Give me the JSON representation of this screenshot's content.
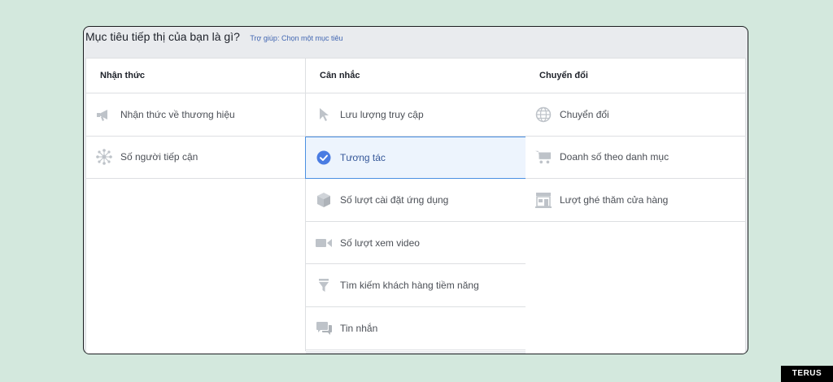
{
  "header": {
    "question": "Mục tiêu tiếp thị của bạn là gì?",
    "help_link": "Trợ giúp: Chọn một mục tiêu"
  },
  "columns": [
    {
      "title": "Nhận thức",
      "items": [
        {
          "label": "Nhận thức về thương hiệu",
          "icon": "megaphone-icon"
        },
        {
          "label": "Số người tiếp cận",
          "icon": "reach-icon"
        }
      ]
    },
    {
      "title": "Cân nhắc",
      "items": [
        {
          "label": "Lưu lượng truy cập",
          "icon": "cursor-icon"
        },
        {
          "label": "Tương tác",
          "icon": "check-circle-icon",
          "selected": true
        },
        {
          "label": "Số lượt cài đặt ứng dụng",
          "icon": "box-icon"
        },
        {
          "label": "Số lượt xem video",
          "icon": "video-camera-icon"
        },
        {
          "label": "Tìm kiếm khách hàng tiềm năng",
          "icon": "funnel-icon"
        },
        {
          "label": "Tin nhắn",
          "icon": "chat-bubbles-icon"
        }
      ]
    },
    {
      "title": "Chuyển đổi",
      "items": [
        {
          "label": "Chuyển đổi",
          "icon": "globe-icon"
        },
        {
          "label": "Doanh số theo danh mục",
          "icon": "cart-icon"
        },
        {
          "label": "Lượt ghé thăm cửa hàng",
          "icon": "store-icon"
        }
      ]
    }
  ],
  "watermark": "TERUS",
  "colors": {
    "background": "#d3e8dd",
    "selected_border": "#4a90e2",
    "selected_bg": "#edf4fd",
    "link": "#4267b2",
    "icon": "#bec3c9",
    "check": "#4a7ce2"
  }
}
